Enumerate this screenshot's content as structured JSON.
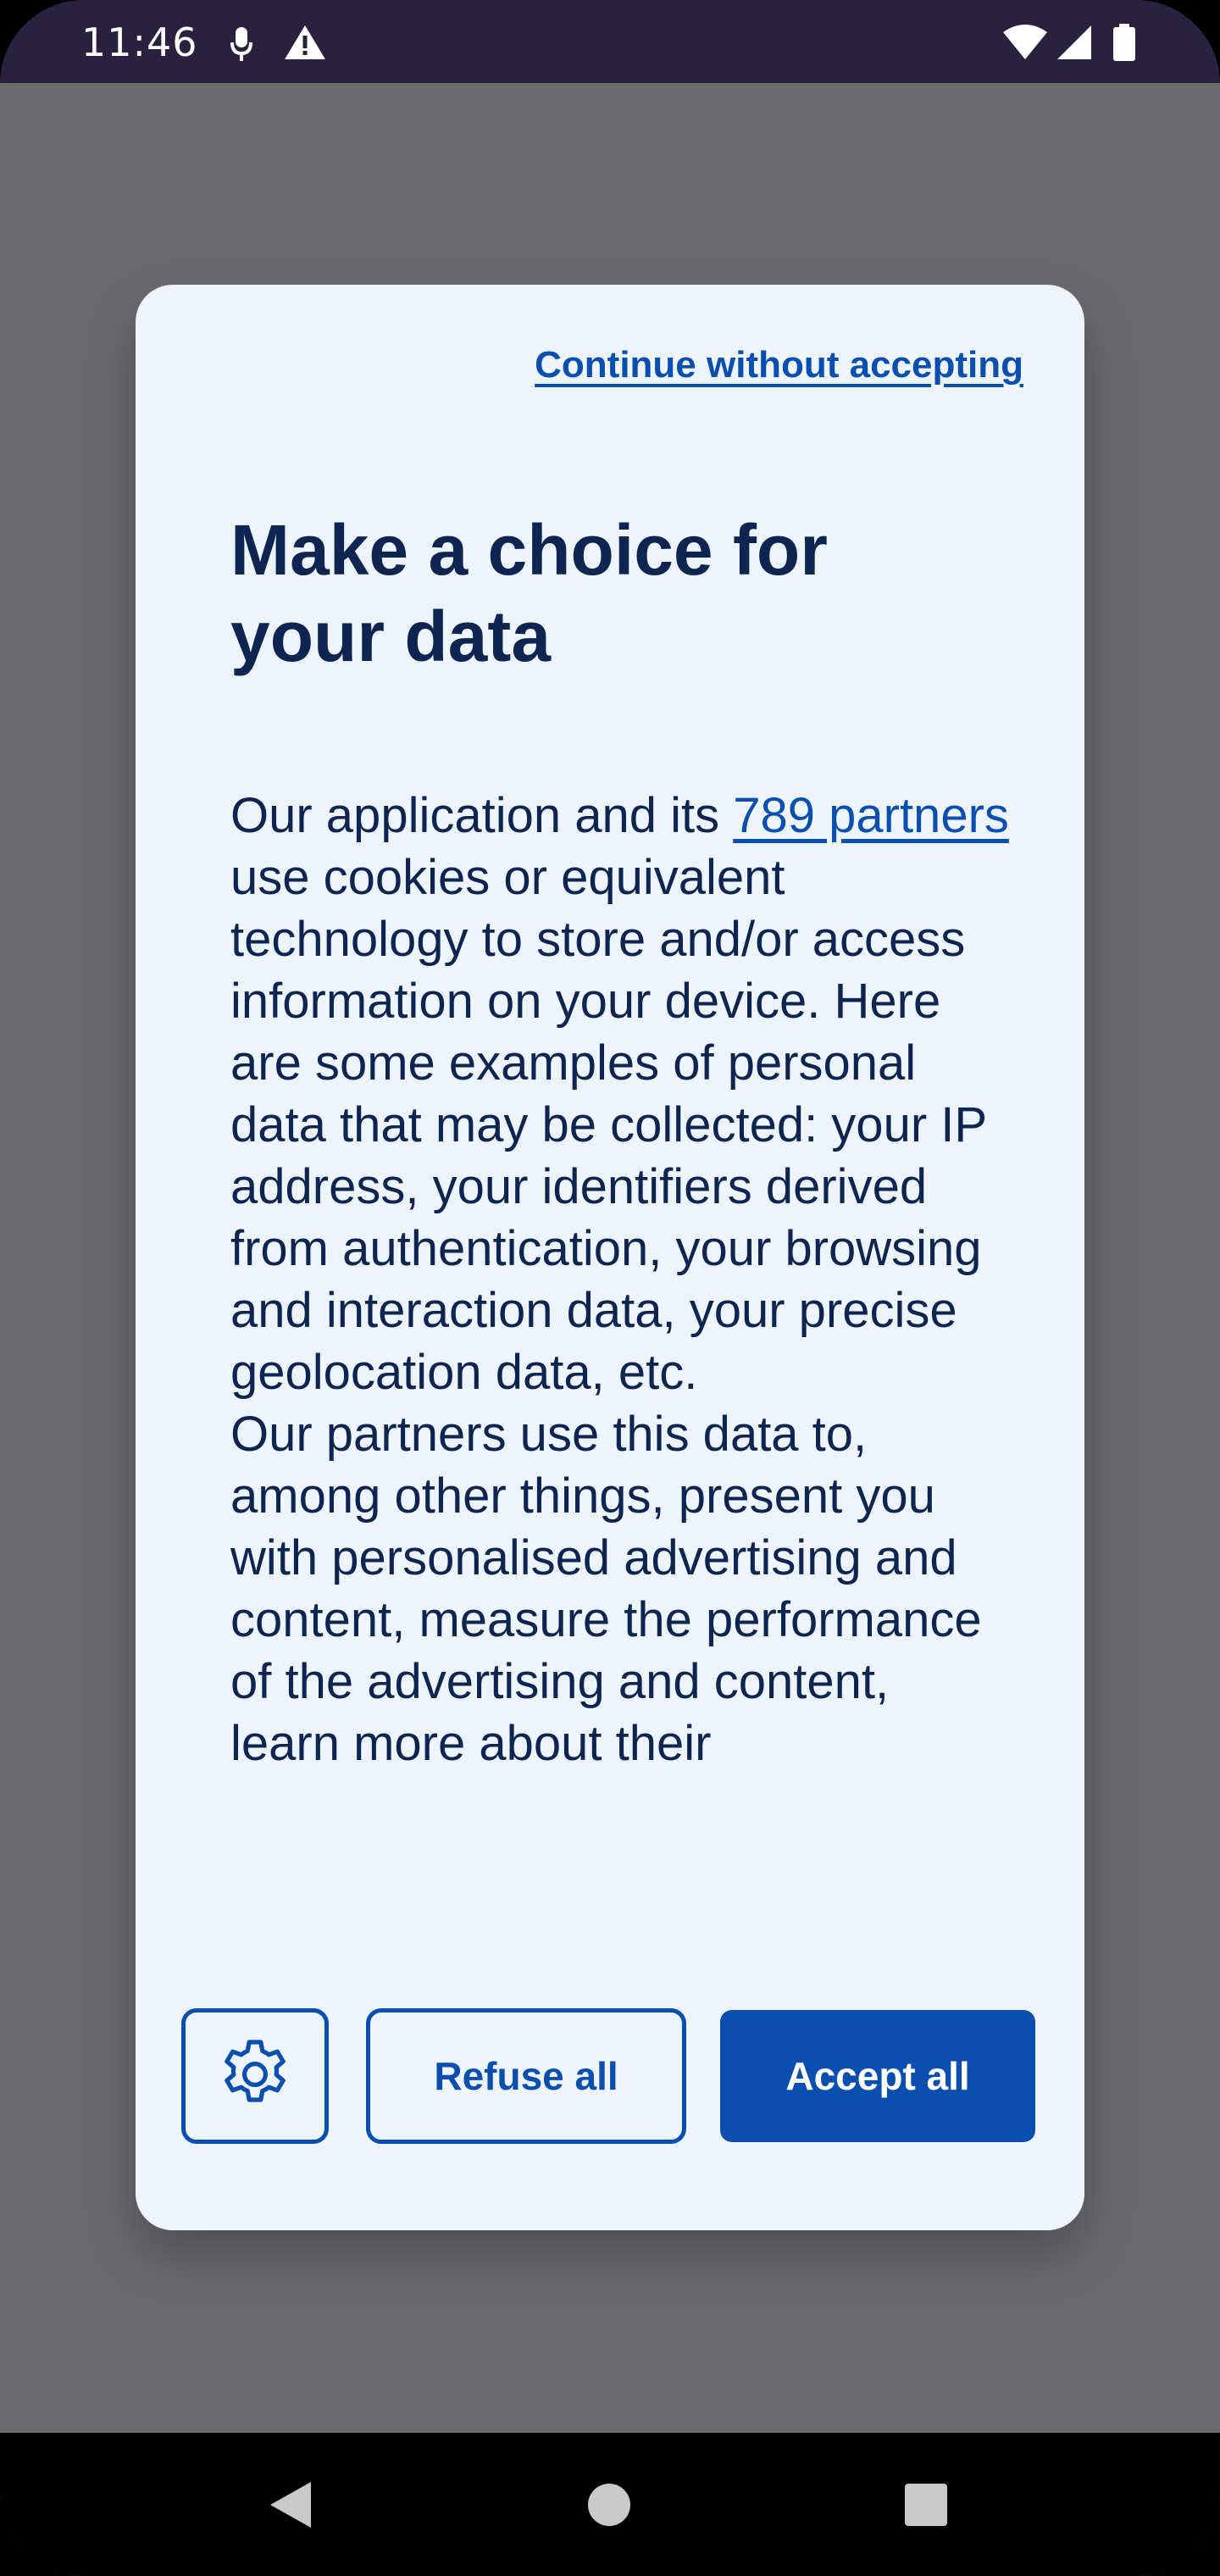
{
  "status_bar": {
    "time": "11:46",
    "left_icons": [
      "microphone-icon",
      "warning-icon"
    ],
    "right_icons": [
      "wifi-icon",
      "cellular-signal-icon",
      "battery-icon"
    ]
  },
  "dialog": {
    "continue_link": "Continue without accepting",
    "title": "Make a choice for your data",
    "body": {
      "intro_before_link": "Our application and its ",
      "partners_link": "789 partners",
      "intro_after_link": " use cookies or equivalent technology to store and/or access information on your device. Here are some examples of personal data that may be collected: your IP address, your identifiers derived from authentication, your browsing and interaction data, your precise geolocation data, etc.",
      "paragraph_2": "Our partners use this data to, among other things, present you with personalised advertising and content, measure the performance of the advertising and content, learn more about their"
    },
    "buttons": {
      "settings_icon": "gear-icon",
      "refuse": "Refuse all",
      "accept": "Accept all"
    }
  },
  "nav_bar": {
    "buttons": [
      "back-icon",
      "home-icon",
      "recents-icon"
    ]
  },
  "colors": {
    "status_bar_bg": "#2a2140",
    "scrim": "#6b6a6d",
    "dialog_bg": "#edf4fc",
    "primary": "#0a4fb0",
    "text": "#0d2550"
  }
}
